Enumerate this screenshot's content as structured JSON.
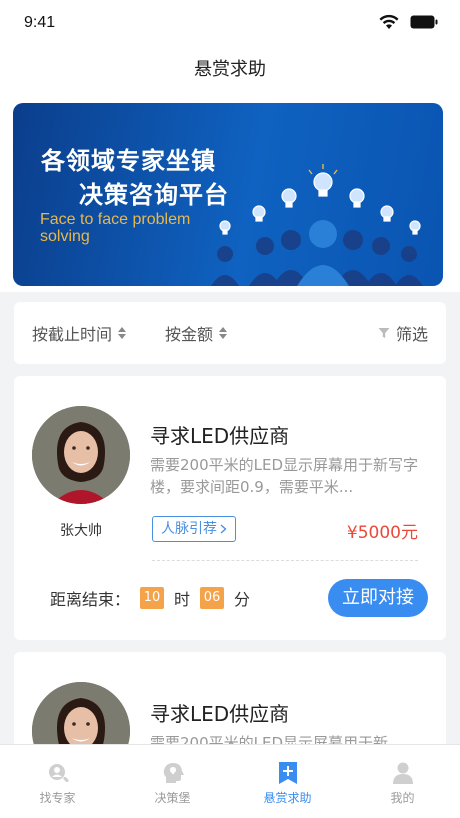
{
  "status_bar": {
    "time": "9:41"
  },
  "nav": {
    "title": "悬赏求助"
  },
  "banner": {
    "line1": "各领域专家坐镇",
    "line2": "决策咨询平台",
    "english_line1": "Face to face problem",
    "english_line2": "solving"
  },
  "filters": {
    "deadline": "按截止时间",
    "amount": "按金额",
    "filter": "筛选"
  },
  "cards": [
    {
      "title": "寻求LED供应商",
      "description": "需要200平米的LED显示屏幕用于新写字楼，要求间距0.9，需要平米...",
      "author": "张大帅",
      "tag": "人脉引荐",
      "price": "¥5000元",
      "countdown_label": "距离结束：",
      "hours": "10",
      "hours_unit": "时",
      "minutes": "06",
      "minutes_unit": "分",
      "button": "立即对接"
    },
    {
      "title": "寻求LED供应商",
      "description": "需要200平米的LED显示屏幕用于新"
    }
  ],
  "tabs": [
    {
      "label": "找专家",
      "icon": "search-person-icon"
    },
    {
      "label": "决策堡",
      "icon": "head-idea-icon"
    },
    {
      "label": "悬赏求助",
      "icon": "bookmark-plus-icon",
      "active": true
    },
    {
      "label": "我的",
      "icon": "user-icon"
    }
  ],
  "colors": {
    "accent": "#3a8df0",
    "price": "#e84a3b",
    "countdown": "#f5a34a",
    "banner": "#0f62c1"
  }
}
